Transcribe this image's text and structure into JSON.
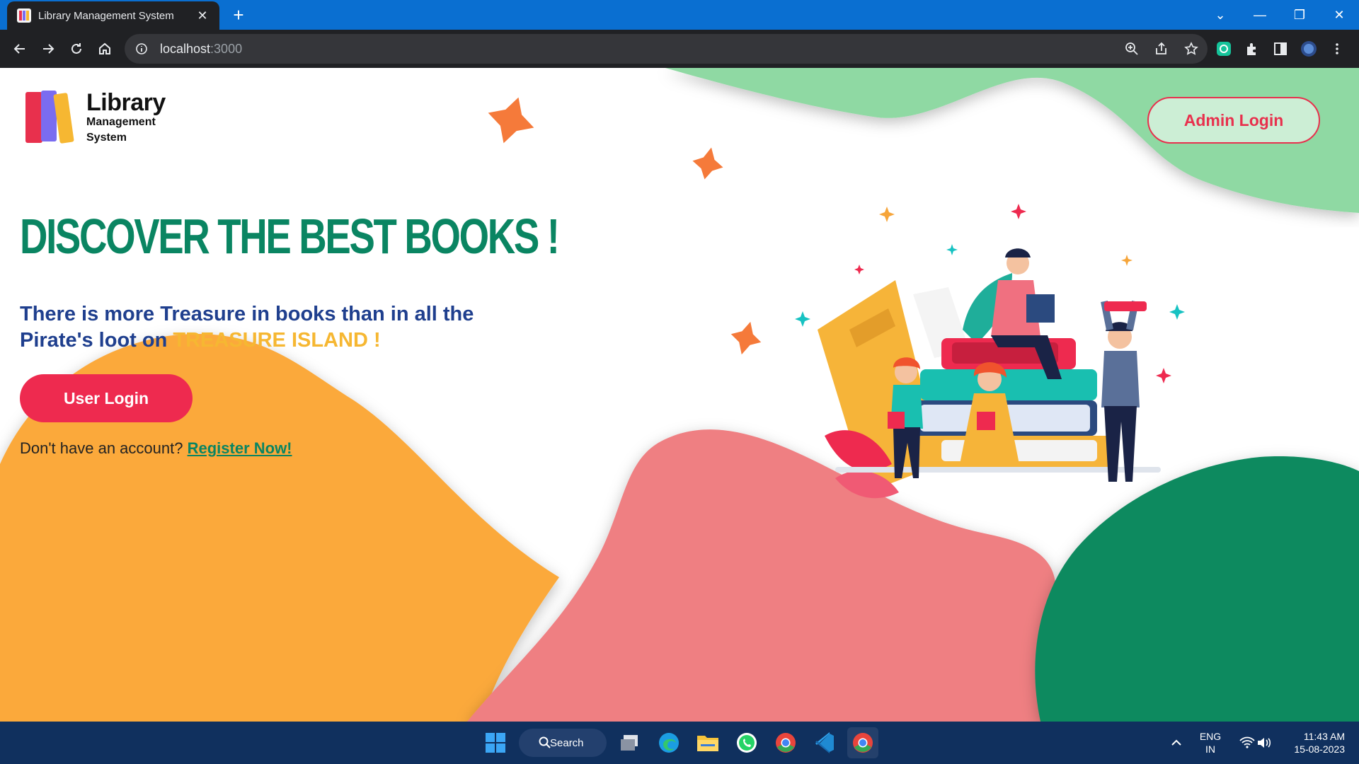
{
  "browser": {
    "tab_title": "Library Management System",
    "url_host": "localhost",
    "url_port": ":3000"
  },
  "page": {
    "logo": {
      "line1": "Library",
      "line2": "Management",
      "line3": "System"
    },
    "admin_login_label": "Admin Login",
    "headline": "DISCOVER THE BEST BOOKS !",
    "tagline_main": "There is more Treasure in books than in all the Pirate's loot on ",
    "tagline_accent": "TREASURE ISLAND !",
    "user_login_label": "User Login",
    "register_prompt": "Don't have an account? ",
    "register_link": "Register Now!",
    "colors": {
      "primary_red": "#ee2a4f",
      "headline_green": "#0a8562",
      "tagline_blue": "#1f3f8e",
      "accent_yellow": "#f6b732",
      "blob_orange": "#fba93a",
      "blob_pink": "#ef7f82",
      "blob_green": "#0b8a5f",
      "blob_lightgreen": "#8fd9a3"
    }
  },
  "taskbar": {
    "search_label": "Search",
    "lang_line1": "ENG",
    "lang_line2": "IN",
    "time": "11:43 AM",
    "date": "15-08-2023"
  }
}
